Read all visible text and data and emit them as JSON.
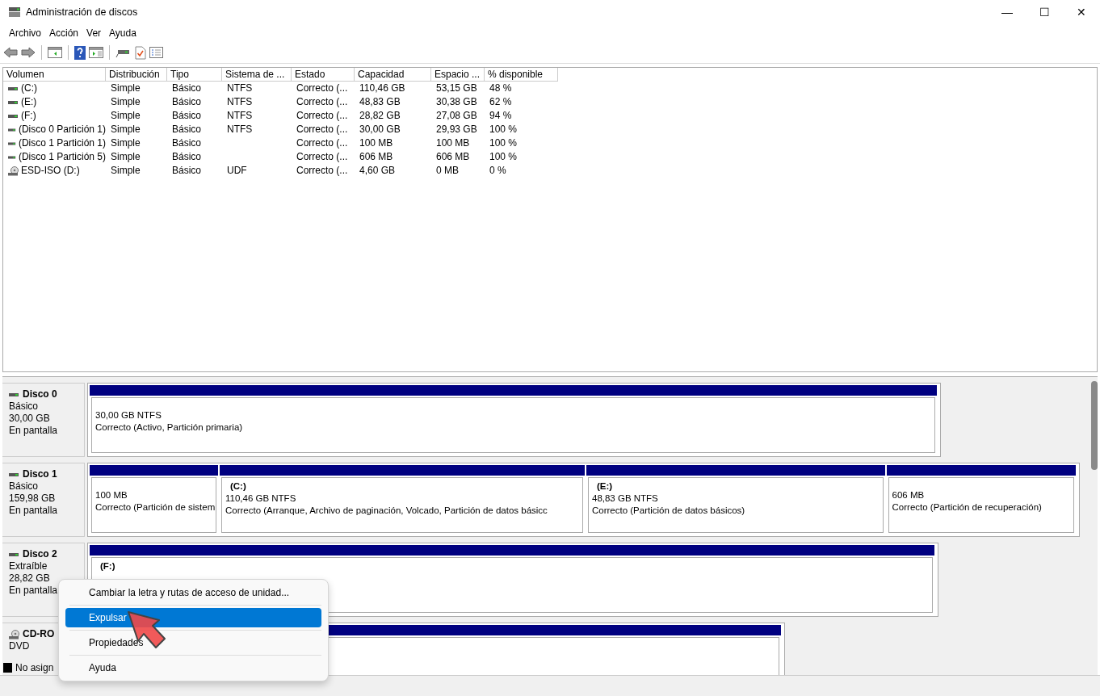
{
  "window": {
    "title": "Administración de discos",
    "controls": [
      "—",
      "☐",
      "✕"
    ]
  },
  "menu": [
    "Archivo",
    "Acción",
    "Ver",
    "Ayuda"
  ],
  "table": {
    "columns": [
      "Volumen",
      "Distribución",
      "Tipo",
      "Sistema de ...",
      "Estado",
      "Capacidad",
      "Espacio ...",
      "% disponible"
    ],
    "rows": [
      {
        "kind": "disk",
        "cells": [
          "(C:)",
          "Simple",
          "Básico",
          "NTFS",
          "Correcto (...",
          "110,46 GB",
          "53,15 GB",
          "48 %"
        ]
      },
      {
        "kind": "disk",
        "cells": [
          "(E:)",
          "Simple",
          "Básico",
          "NTFS",
          "Correcto (...",
          "48,83 GB",
          "30,38 GB",
          "62 %"
        ]
      },
      {
        "kind": "disk",
        "cells": [
          "(F:)",
          "Simple",
          "Básico",
          "NTFS",
          "Correcto (...",
          "28,82 GB",
          "27,08 GB",
          "94 %"
        ]
      },
      {
        "kind": "disk",
        "cells": [
          "(Disco 0 Partición 1)",
          "Simple",
          "Básico",
          "NTFS",
          "Correcto (...",
          "30,00 GB",
          "29,93 GB",
          "100 %"
        ]
      },
      {
        "kind": "disk",
        "cells": [
          "(Disco 1 Partición 1)",
          "Simple",
          "Básico",
          "",
          "Correcto (...",
          "100 MB",
          "100 MB",
          "100 %"
        ]
      },
      {
        "kind": "disk",
        "cells": [
          "(Disco 1 Partición 5)",
          "Simple",
          "Básico",
          "",
          "Correcto (...",
          "606 MB",
          "606 MB",
          "100 %"
        ]
      },
      {
        "kind": "optical",
        "cells": [
          "ESD-ISO (D:)",
          "Simple",
          "Básico",
          "UDF",
          "Correcto (...",
          "4,60 GB",
          "0 MB",
          "0 %"
        ]
      }
    ]
  },
  "disks": [
    {
      "kind": "disk",
      "name": "Disco 0",
      "lines": [
        "Básico",
        "30,00 GB",
        "En pantalla"
      ],
      "partitions": [
        {
          "size": "30,00 GB NTFS",
          "status": "Correcto (Activo, Partición primaria)"
        }
      ]
    },
    {
      "kind": "disk",
      "name": "Disco 1",
      "lines": [
        "Básico",
        "159,98 GB",
        "En pantalla"
      ],
      "partitions": [
        {
          "size": "100 MB",
          "status": "Correcto (Partición de sistem"
        },
        {
          "label": "(C:)",
          "size": "110,46 GB NTFS",
          "status": "Correcto (Arranque, Archivo de paginación, Volcado, Partición de datos básicc"
        },
        {
          "label": "(E:)",
          "size": "48,83 GB NTFS",
          "status": "Correcto (Partición de datos básicos)"
        },
        {
          "size": "606 MB",
          "status": "Correcto (Partición de recuperación)"
        }
      ]
    },
    {
      "kind": "disk",
      "name": "Disco 2",
      "lines": [
        "Extraíble",
        "28,82 GB",
        "En pantalla"
      ],
      "partitions": [
        {
          "label": "(F:)"
        }
      ]
    },
    {
      "kind": "optical",
      "name": "CD-RO",
      "lines": [
        "DVD"
      ]
    }
  ],
  "legend": [
    {
      "label": "No asign",
      "color": "#000000"
    }
  ],
  "context_menu": [
    {
      "label": "Cambiar la letra y rutas de acceso de unidad...",
      "selected": false
    },
    {
      "label": "Expulsar",
      "selected": true
    },
    {
      "label": "Propiedades",
      "selected": false
    },
    {
      "label": "Ayuda",
      "selected": false
    }
  ]
}
